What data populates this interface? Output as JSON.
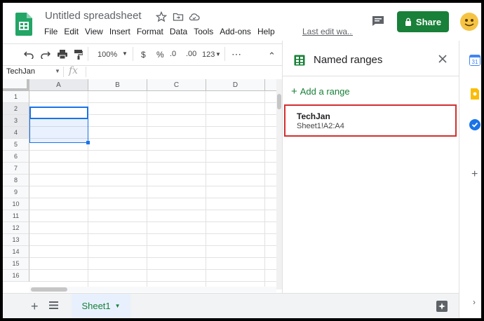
{
  "app": {
    "title": "Untitled spreadsheet",
    "menu": [
      "File",
      "Edit",
      "View",
      "Insert",
      "Format",
      "Data",
      "Tools",
      "Add-ons",
      "Help"
    ],
    "last_edit": "Last edit wa...",
    "share_label": "Share",
    "colors": {
      "accent": "#188038",
      "selection": "#1a73e8",
      "highlight": "#d32f2f"
    }
  },
  "toolbar": {
    "zoom": "100%",
    "currency": "$",
    "percent": "%",
    "dec_decrease": ".0",
    "dec_increase": ".00",
    "format_more": "123",
    "more": "⋯",
    "collapse": "⌃"
  },
  "formula_bar": {
    "name_box": "TechJan",
    "fx": "fx"
  },
  "grid": {
    "columns": [
      "A",
      "B",
      "C",
      "D"
    ],
    "rows": [
      "1",
      "2",
      "3",
      "4",
      "5",
      "6",
      "7",
      "8",
      "9",
      "10",
      "11",
      "12",
      "13",
      "14",
      "15",
      "16"
    ]
  },
  "sheets": {
    "add": "+",
    "active_tab": "Sheet1"
  },
  "named_ranges": {
    "title": "Named ranges",
    "add_range": "Add a range",
    "ranges": [
      {
        "name": "TechJan",
        "ref": "Sheet1!A2:A4"
      }
    ]
  },
  "icons": [
    "sheets-logo-icon",
    "star-icon",
    "move-folder-icon",
    "cloud-status-icon",
    "comment-icon",
    "lock-icon",
    "undo-icon",
    "redo-icon",
    "print-icon",
    "paint-format-icon",
    "close-icon",
    "explore-icon",
    "calendar-icon",
    "keep-icon",
    "tasks-icon",
    "plus-icon"
  ]
}
